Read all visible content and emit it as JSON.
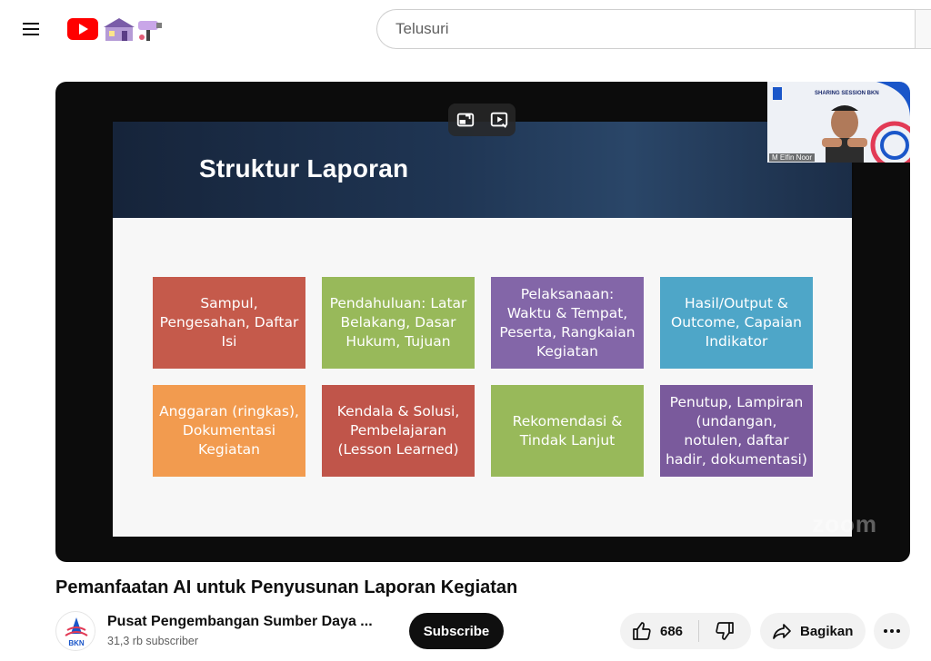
{
  "masthead": {
    "search_placeholder": "Telusuri",
    "icons": [
      "menu-icon",
      "youtube-logo-icon",
      "search-icon"
    ]
  },
  "player": {
    "slide_title": "Struktur Laporan",
    "cards": [
      {
        "text": "Sampul, Pengesahan, Daftar Isi",
        "color": "#c55a4b"
      },
      {
        "text": "Pendahuluan: Latar Belakang, Dasar Hukum, Tujuan",
        "color": "#98b95a"
      },
      {
        "text": "Pelaksanaan: Waktu & Tempat, Peserta, Rangkaian Kegiatan",
        "color": "#8366a8"
      },
      {
        "text": "Hasil/Output & Outcome, Capaian Indikator",
        "color": "#4ea6c8"
      },
      {
        "text": "Anggaran (ringkas), Dokumentasi Kegiatan",
        "color": "#f29b4f"
      },
      {
        "text": "Kendala & Solusi, Pembelajaran (Lesson Learned)",
        "color": "#c0554a"
      },
      {
        "text": "Rekomendasi & Tindak Lanjut",
        "color": "#98b95a"
      },
      {
        "text": "Penutup, Lampiran (undangan, notulen, daftar hadir, dokumentasi)",
        "color": "#7a5a9c"
      }
    ],
    "watermark": "zoom",
    "camera": {
      "speaker_label": "M Elfin Noor",
      "banner": "SHARING SESSION BKN"
    }
  },
  "video": {
    "title": "Pemanfaatan AI untuk Penyusunan Laporan Kegiatan"
  },
  "channel": {
    "name": "Pusat Pengembangan Sumber Daya ...",
    "subscribers": "31,3 rb subscriber",
    "avatar_text": "BKN",
    "subscribe_label": "Subscribe"
  },
  "actions": {
    "like_count": "686",
    "share_label": "Bagikan"
  },
  "colors": {
    "brand_red": "#ff0000",
    "subscribe_bg": "#0f0f0f",
    "pill_bg": "#f2f2f2"
  }
}
